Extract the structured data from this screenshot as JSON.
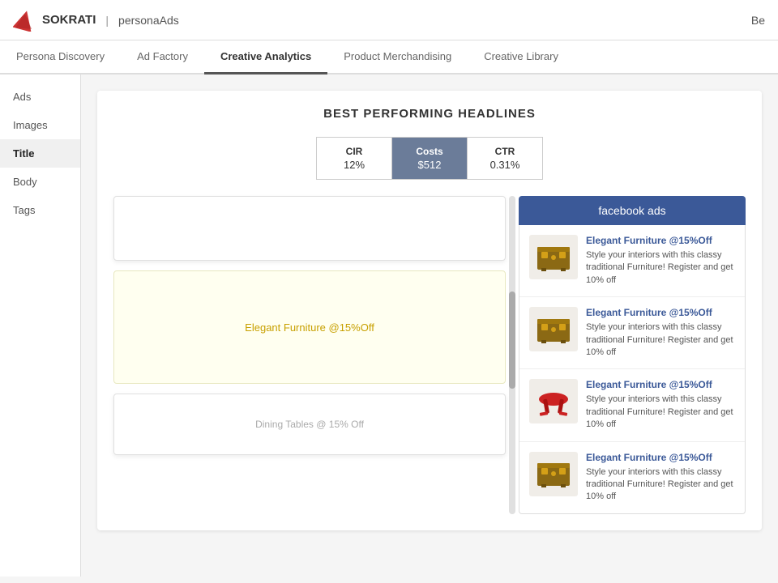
{
  "header": {
    "logo_text": "SOKRATI",
    "separator": "|",
    "product_name": "personaAds",
    "right_text": "Be"
  },
  "nav": {
    "tabs": [
      {
        "label": "Persona Discovery",
        "active": false
      },
      {
        "label": "Ad Factory",
        "active": false
      },
      {
        "label": "Creative Analytics",
        "active": true
      },
      {
        "label": "Product Merchandising",
        "active": false
      },
      {
        "label": "Creative Library",
        "active": false
      }
    ]
  },
  "sidebar": {
    "items": [
      {
        "label": "Ads",
        "active": false
      },
      {
        "label": "Images",
        "active": false
      },
      {
        "label": "Title",
        "active": true
      },
      {
        "label": "Body",
        "active": false
      },
      {
        "label": "Tags",
        "active": false
      }
    ]
  },
  "panel": {
    "title": "BEST PERFORMING HEADLINES",
    "metrics": [
      {
        "label": "CIR",
        "value": "12%",
        "active": false
      },
      {
        "label": "Costs",
        "value": "$512",
        "active": true
      },
      {
        "label": "CTR",
        "value": "0.31%",
        "active": false
      }
    ],
    "card1_text": "",
    "card2_text": "Elegant Furniture @15%Off",
    "card3_text": "Dining Tables @ 15% Off",
    "facebook_header": "facebook ads",
    "ads": [
      {
        "title": "Elegant Furniture @15%Off",
        "desc": "Style your interiors with this classy traditional Furniture! Register and get 10% off",
        "image_type": "chest"
      },
      {
        "title": "Elegant Furniture @15%Off",
        "desc": "Style your interiors with this classy traditional Furniture! Register and get 10% off",
        "image_type": "chest"
      },
      {
        "title": "Elegant Furniture @15%Off",
        "desc": "Style your interiors with this classy traditional Furniture! Register and get 10% off",
        "image_type": "stool"
      },
      {
        "title": "Elegant Furniture @15%Off",
        "desc": "Style your interiors with this classy traditional Furniture! Register and get 10% off",
        "image_type": "chest"
      }
    ]
  },
  "colors": {
    "fb_blue": "#3b5998",
    "metric_active_bg": "#6b7c99",
    "yellow_card_bg": "#fffff0"
  }
}
